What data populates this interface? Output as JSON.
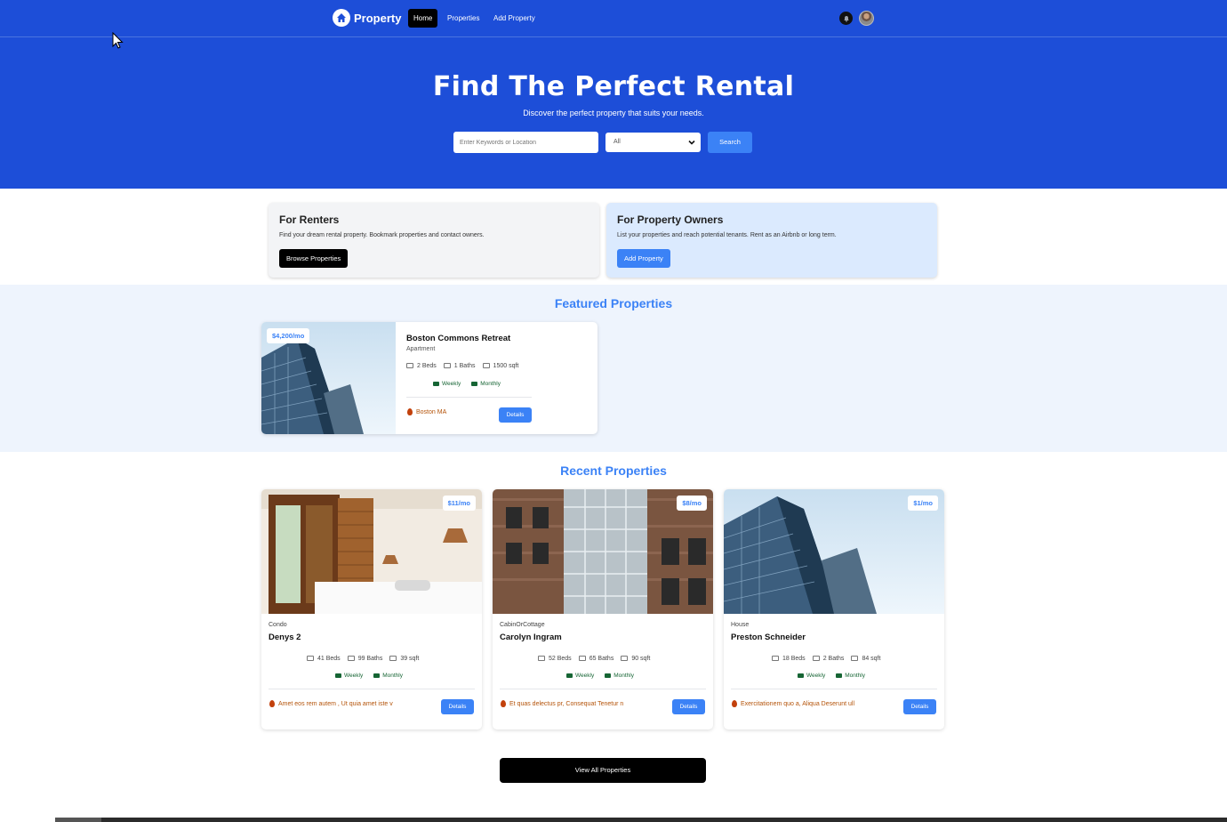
{
  "nav": {
    "brand": "Property",
    "links": [
      "Home",
      "Properties",
      "Add Property"
    ],
    "icons": [
      "bell-icon",
      "avatar"
    ]
  },
  "hero": {
    "title": "Find The Perfect Rental",
    "subtitle": "Discover the perfect property that suits your needs.",
    "search_placeholder": "Enter Keywords or Location",
    "select_value": "All",
    "search_button": "Search"
  },
  "renters": {
    "title": "For Renters",
    "text": "Find your dream rental property. Bookmark properties and contact owners.",
    "button": "Browse Properties"
  },
  "owners": {
    "title": "For Property Owners",
    "text": "List your properties and reach potential tenants. Rent as an Airbnb or long term.",
    "button": "Add Property"
  },
  "featured": {
    "heading": "Featured Properties",
    "card": {
      "price": "$4,200/mo",
      "name": "Boston Commons Retreat",
      "type": "Apartment",
      "beds": "2 Beds",
      "baths": "1 Baths",
      "sqft": "1500 sqft",
      "rates": [
        "Weekly",
        "Monthly"
      ],
      "location": "Boston MA",
      "details": "Details"
    }
  },
  "recent": {
    "heading": "Recent Properties",
    "cards": [
      {
        "price": "$11/mo",
        "type": "Condo",
        "name": "Denys 2",
        "beds": "41 Beds",
        "baths": "99 Baths",
        "sqft": "39 sqft",
        "rates": [
          "Weekly",
          "Monthly"
        ],
        "location": "Amet eos rem autem , Ut quia amet iste v",
        "details": "Details"
      },
      {
        "price": "$8/mo",
        "type": "CabinOrCottage",
        "name": "Carolyn Ingram",
        "beds": "52 Beds",
        "baths": "65 Baths",
        "sqft": "90 sqft",
        "rates": [
          "Weekly",
          "Monthly"
        ],
        "location": "Et quas delectus pr, Consequat Tenetur n",
        "details": "Details"
      },
      {
        "price": "$1/mo",
        "type": "House",
        "name": "Preston Schneider",
        "beds": "18 Beds",
        "baths": "2 Baths",
        "sqft": "84 sqft",
        "rates": [
          "Weekly",
          "Monthly"
        ],
        "location": "Exercitationem quo a, Aliqua Deserunt ull",
        "details": "Details"
      }
    ]
  },
  "view_all": "View All Properties",
  "colors": {
    "primary": "#1d4ed8",
    "accent": "#3b82f6",
    "featured_bg": "#eef4fd",
    "owner_bg": "#dbeafe",
    "renter_bg": "#f3f4f6"
  }
}
